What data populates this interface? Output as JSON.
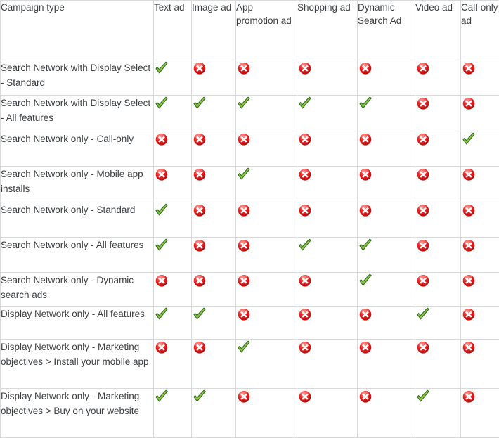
{
  "table": {
    "columns": [
      {
        "key": "campaign_type",
        "label": "Campaign type"
      },
      {
        "key": "text_ad",
        "label": "Text ad"
      },
      {
        "key": "image_ad",
        "label": "Image ad"
      },
      {
        "key": "app_promotion_ad",
        "label": "App promotion ad"
      },
      {
        "key": "shopping_ad",
        "label": "Shopping ad"
      },
      {
        "key": "dynamic_search_ad",
        "label": "Dynamic Search Ad"
      },
      {
        "key": "video_ad",
        "label": "Video ad"
      },
      {
        "key": "call_only_ad",
        "label": "Call-only ad"
      }
    ],
    "rows": [
      {
        "label": "Search Network with Display Select - Standard",
        "values": [
          "yes",
          "no",
          "no",
          "no",
          "no",
          "no",
          "no"
        ]
      },
      {
        "label": "Search Network with Display Select - All features",
        "values": [
          "yes",
          "yes",
          "yes",
          "yes",
          "yes",
          "no",
          "no"
        ]
      },
      {
        "label": "Search Network only - Call-only",
        "values": [
          "no",
          "no",
          "no",
          "no",
          "no",
          "no",
          "yes"
        ]
      },
      {
        "label": "Search Network only - Mobile app installs",
        "values": [
          "no",
          "no",
          "yes",
          "no",
          "no",
          "no",
          "no"
        ]
      },
      {
        "label": "Search Network only - Standard",
        "values": [
          "yes",
          "no",
          "no",
          "no",
          "no",
          "no",
          "no"
        ]
      },
      {
        "label": "Search Network only - All features",
        "values": [
          "yes",
          "no",
          "no",
          "yes",
          "yes",
          "no",
          "no"
        ]
      },
      {
        "label": "Search Network only - Dynamic search ads",
        "values": [
          "no",
          "no",
          "no",
          "no",
          "yes",
          "no",
          "no"
        ]
      },
      {
        "label": "Display Network only - All features",
        "values": [
          "yes",
          "yes",
          "no",
          "no",
          "no",
          "yes",
          "no"
        ]
      },
      {
        "label": "Display Network only - Marketing objectives > Install your mobile app",
        "values": [
          "no",
          "no",
          "yes",
          "no",
          "no",
          "no",
          "no"
        ]
      },
      {
        "label": "Display Network only - Marketing objectives > Buy on your website",
        "values": [
          "yes",
          "yes",
          "no",
          "no",
          "no",
          "yes",
          "no"
        ]
      }
    ],
    "icons": {
      "yes": "green-check-icon",
      "no": "red-x-circle-icon"
    }
  },
  "colors": {
    "border": "#d9d9d9",
    "text": "#3c4043",
    "check_fill": "#8dc63f",
    "check_outline": "#2f6b1f",
    "x_circle": "#e01b1b",
    "x_glyph": "#ffffff",
    "background": "#ffffff"
  }
}
